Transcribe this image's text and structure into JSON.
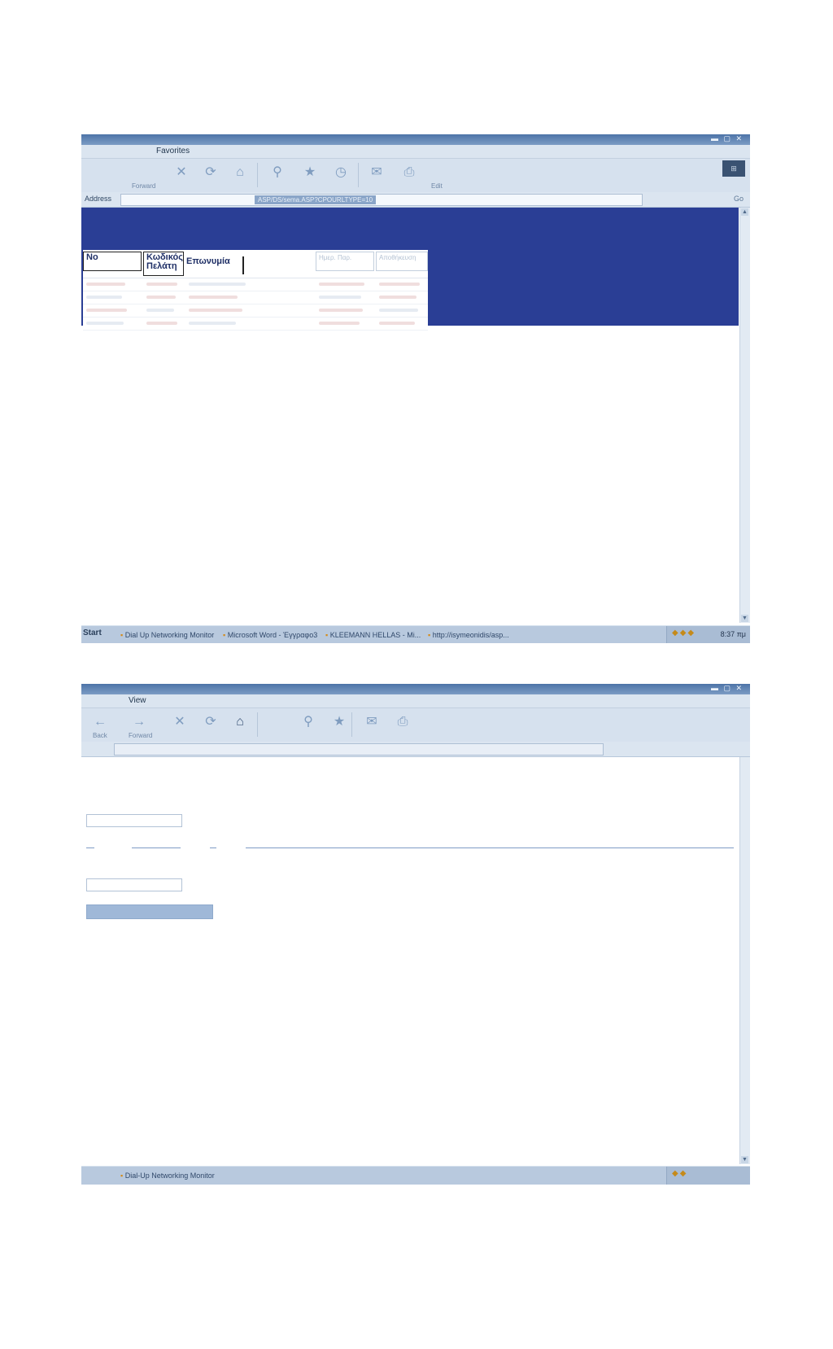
{
  "window1": {
    "menu_label": "Favorites",
    "toolbar": {
      "forward_label": "Forward",
      "edit_label": "Edit"
    },
    "address_label": "Address",
    "address_url": "ASP/DS/sema.ASP?CPOURLTYPE=10",
    "go_label": "Go",
    "grid": {
      "headers": [
        "No",
        "Κωδικός\nΠελάτη",
        "Επωνυμία"
      ],
      "faint_headers": [
        "Ημερ. Παρ.",
        "Αποθήκευση"
      ]
    },
    "taskbar": {
      "start": "Start",
      "items": [
        "Dial Up Networking Monitor",
        "Microsoft Word - Έγγραφο3",
        "KLEEMANN HELLAS - Mi...",
        "http://isymeonidis/asp..."
      ],
      "clock": "8:37 πμ"
    }
  },
  "window2": {
    "menu_label": "View",
    "toolbar": {
      "back_label": "Back",
      "forward_label": "Forward"
    },
    "taskbar": {
      "items": [
        "Dial-Up Networking Monitor"
      ]
    }
  },
  "icons": {
    "back": "back-arrow-icon",
    "forward": "forward-arrow-icon",
    "home": "home-icon"
  },
  "colors": {
    "panel_blue": "#2a3e95",
    "chrome": "#d6e1ee",
    "title_blue": "#4d74a8"
  }
}
